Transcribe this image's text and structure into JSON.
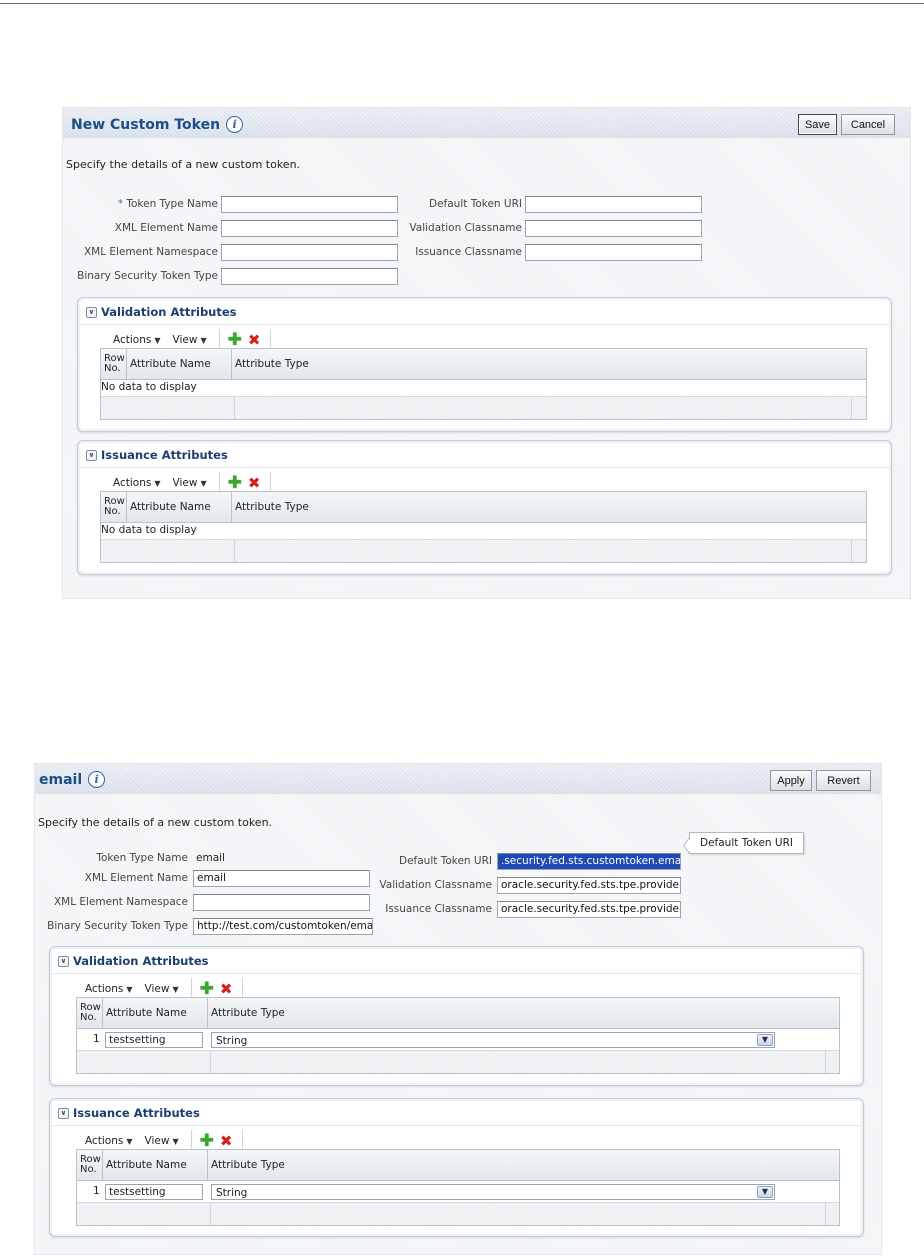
{
  "new_token": {
    "title": "New Custom Token",
    "save_label": "Save",
    "cancel_label": "Cancel",
    "description": "Specify the details of a new custom token.",
    "required_marker": "*",
    "fields": {
      "token_type_name": {
        "label": "Token Type Name",
        "value": ""
      },
      "xml_element_name": {
        "label": "XML Element Name",
        "value": ""
      },
      "xml_element_namespace": {
        "label": "XML Element Namespace",
        "value": ""
      },
      "binary_security_token_type": {
        "label": "Binary Security Token Type",
        "value": ""
      },
      "default_token_uri": {
        "label": "Default Token URI",
        "value": ""
      },
      "validation_classname": {
        "label": "Validation Classname",
        "value": ""
      },
      "issuance_classname": {
        "label": "Issuance Classname",
        "value": ""
      }
    },
    "validation": {
      "title": "Validation Attributes",
      "actions": "Actions",
      "view": "View",
      "col_row_no": "Row No.",
      "col_attr_name": "Attribute Name",
      "col_attr_type": "Attribute Type",
      "empty": "No data to display"
    },
    "issuance": {
      "title": "Issuance Attributes",
      "actions": "Actions",
      "view": "View",
      "col_row_no": "Row No.",
      "col_attr_name": "Attribute Name",
      "col_attr_type": "Attribute Type",
      "empty": "No data to display"
    }
  },
  "email_token": {
    "title": "email",
    "apply_label": "Apply",
    "revert_label": "Revert",
    "description": "Specify the details of a new custom token.",
    "fields": {
      "token_type_name": {
        "label": "Token Type Name",
        "value": "email"
      },
      "xml_element_name": {
        "label": "XML Element Name",
        "value": "email"
      },
      "xml_element_namespace": {
        "label": "XML Element Namespace",
        "value": ""
      },
      "binary_security_token_type": {
        "label": "Binary Security Token Type",
        "value": "http://test.com/customtoken/email"
      },
      "default_token_uri": {
        "label": "Default Token URI",
        "value": ".security.fed.sts.customtoken.email"
      },
      "validation_classname": {
        "label": "Validation Classname",
        "value": "oracle.security.fed.sts.tpe.provider"
      },
      "issuance_classname": {
        "label": "Issuance Classname",
        "value": "oracle.security.fed.sts.tpe.provider"
      }
    },
    "tooltip": "Default Token URI",
    "validation": {
      "title": "Validation Attributes",
      "actions": "Actions",
      "view": "View",
      "col_row_no": "Row No.",
      "col_attr_name": "Attribute Name",
      "col_attr_type": "Attribute Type",
      "rows": [
        {
          "no": "1",
          "name": "testsetting",
          "type": "String"
        }
      ]
    },
    "issuance": {
      "title": "Issuance Attributes",
      "actions": "Actions",
      "view": "View",
      "col_row_no": "Row No.",
      "col_attr_name": "Attribute Name",
      "col_attr_type": "Attribute Type",
      "rows": [
        {
          "no": "1",
          "name": "testsetting",
          "type": "String"
        }
      ]
    }
  },
  "icons": {
    "info": "info-icon",
    "add": "add-icon",
    "delete": "delete-icon",
    "toggle": "collapse-toggle-icon",
    "dropdown": "chevron-down-icon"
  }
}
